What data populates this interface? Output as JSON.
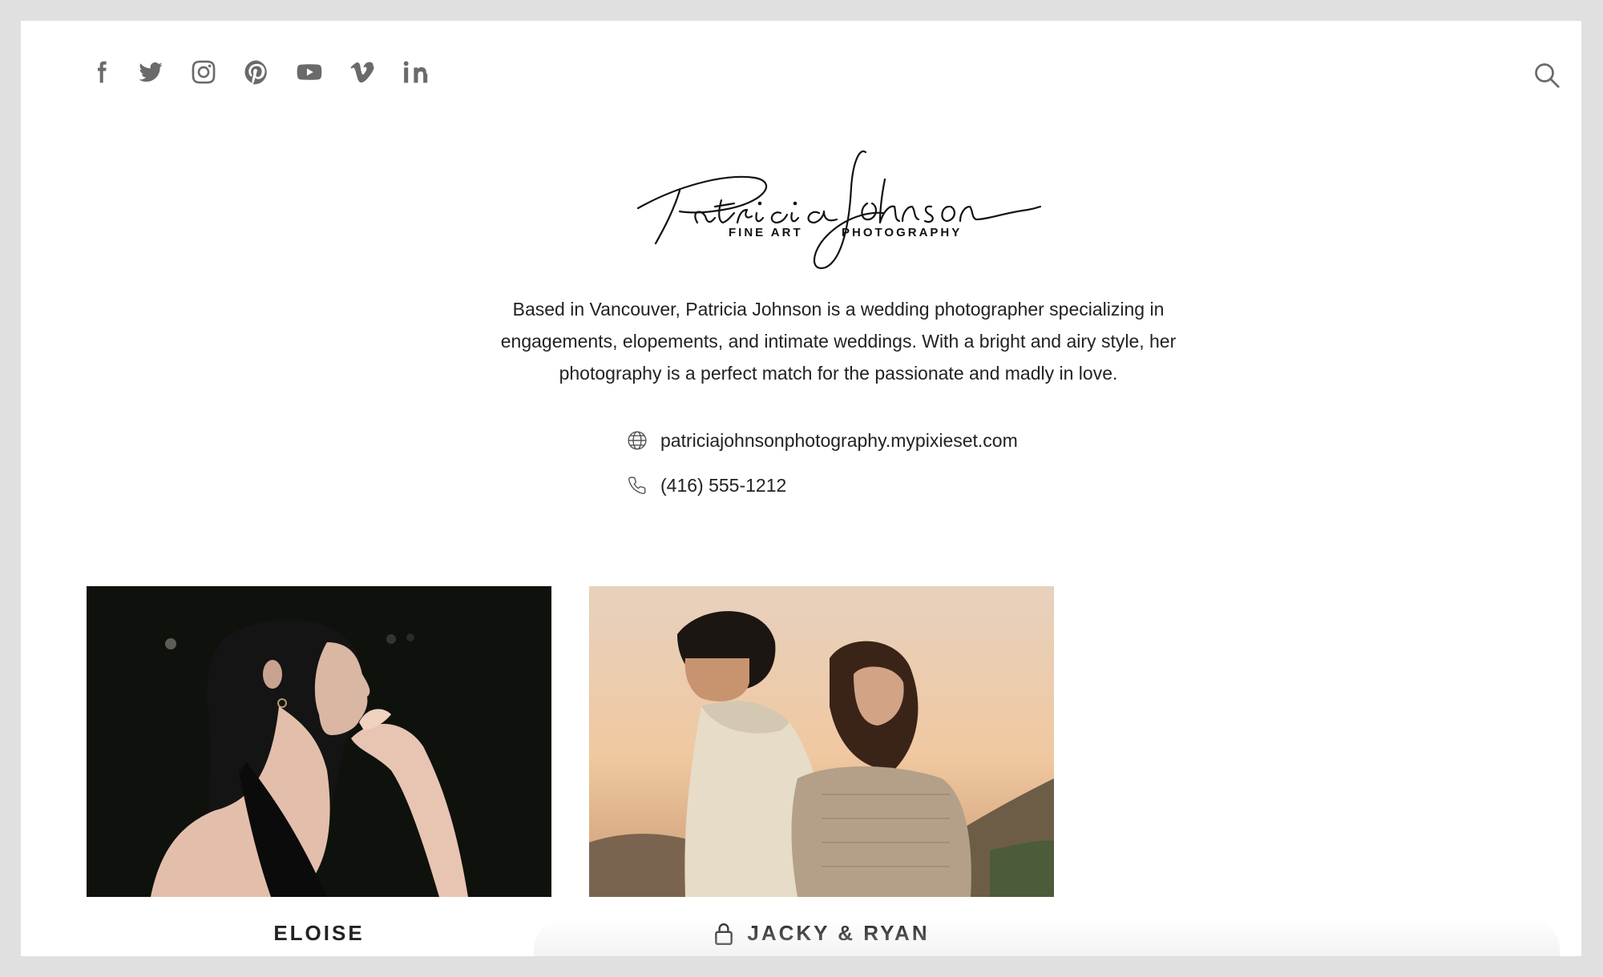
{
  "social": [
    {
      "name": "facebook-icon"
    },
    {
      "name": "twitter-icon"
    },
    {
      "name": "instagram-icon"
    },
    {
      "name": "pinterest-icon"
    },
    {
      "name": "youtube-icon"
    },
    {
      "name": "vimeo-icon"
    },
    {
      "name": "linkedin-icon"
    }
  ],
  "header": {
    "search_icon": "search-icon"
  },
  "logo": {
    "name_script": "Patricia Johnson",
    "subtitle_left": "FINE ART",
    "subtitle_right": "PHOTOGRAPHY"
  },
  "bio": {
    "text": "Based in Vancouver, Patricia Johnson is a wedding photographer specializing in engagements, elopements, and intimate weddings. With a bright and airy style, her photography is a perfect match for the passionate and madly in love."
  },
  "contact": {
    "website": "patriciajohnsonphotography.mypixieset.com",
    "phone": "(416) 555-1212"
  },
  "galleries": [
    {
      "title": "ELOISE",
      "locked": false
    },
    {
      "title": "JACKY & RYAN",
      "locked": true
    }
  ],
  "colors": {
    "page_bg": "#e0e0e0",
    "content_bg": "#ffffff",
    "icon_gray": "#6a6a6a",
    "text": "#222222"
  }
}
